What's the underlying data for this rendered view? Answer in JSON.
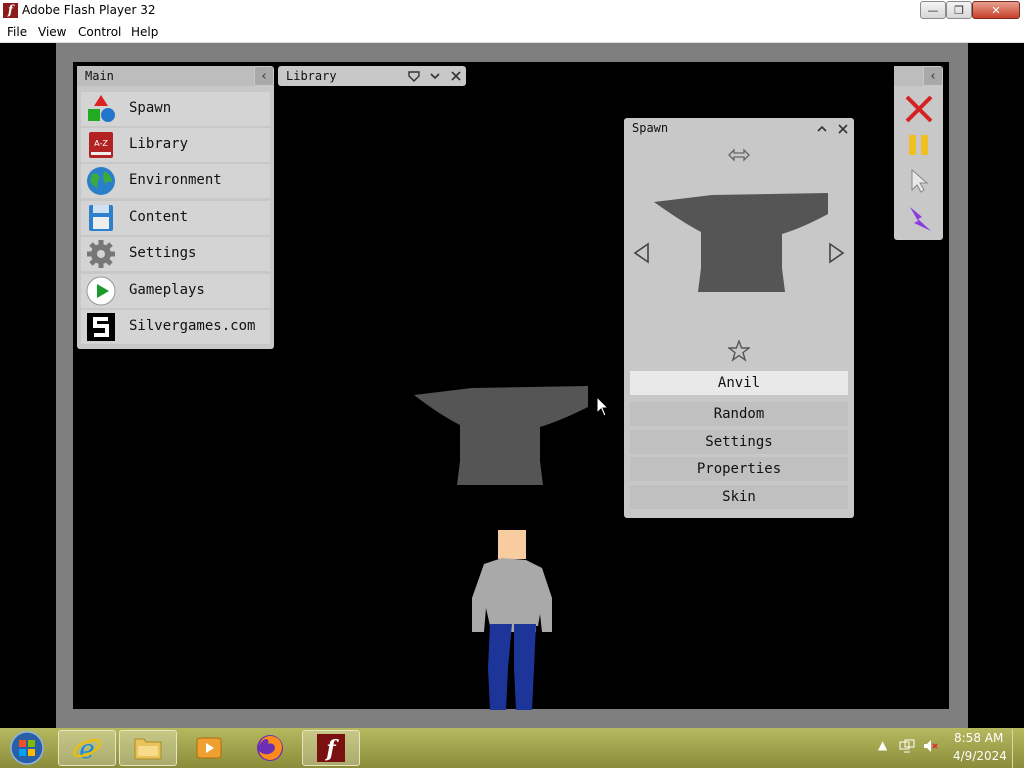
{
  "window": {
    "title": "Adobe Flash Player 32"
  },
  "menu": [
    "File",
    "View",
    "Control",
    "Help"
  ],
  "main_panel": {
    "title": "Main",
    "items": [
      {
        "label": "Spawn",
        "icon": "shapes-icon"
      },
      {
        "label": "Library",
        "icon": "book-az-icon"
      },
      {
        "label": "Environment",
        "icon": "globe-icon"
      },
      {
        "label": "Content",
        "icon": "floppy-icon"
      },
      {
        "label": "Settings",
        "icon": "gear-icon"
      },
      {
        "label": "Gameplays",
        "icon": "play-icon"
      },
      {
        "label": "Silvergames.com",
        "icon": "silvergames-logo-icon"
      }
    ]
  },
  "library_tab": {
    "title": "Library"
  },
  "spawn_panel": {
    "title": "Spawn",
    "item_name": "Anvil",
    "buttons": [
      "Random",
      "Settings",
      "Properties",
      "Skin"
    ]
  },
  "taskbar": {
    "time": "8:58 AM",
    "date": "4/9/2024"
  },
  "colors": {
    "panel": "#c8c8c8",
    "anvil": "#555555",
    "taskbar": "#9fa14c"
  }
}
